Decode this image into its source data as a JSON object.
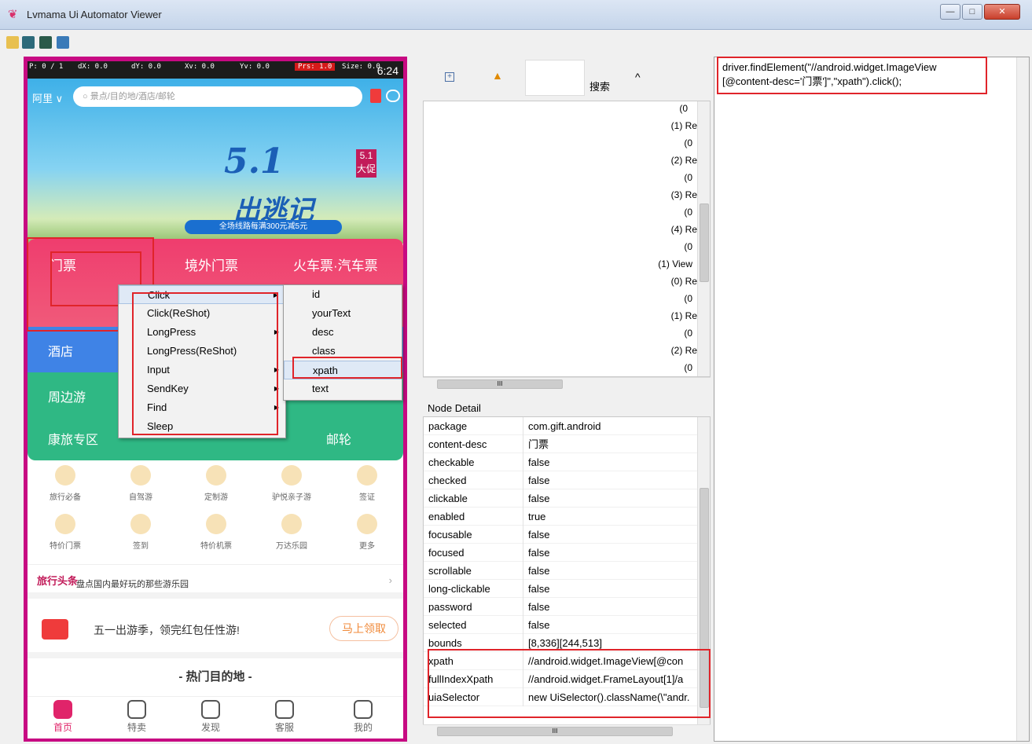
{
  "window": {
    "title": "Lvmama Ui Automator Viewer"
  },
  "phone": {
    "status": {
      "p": "P: 0 / 1",
      "dx": "dX: 0.0",
      "dy": "dY: 0.0",
      "xv": "Xv: 0.0",
      "yv": "Yv: 0.0",
      "prs": "Prs: 1.0",
      "size": "Size: 0.0",
      "time": "6:24"
    },
    "search": {
      "city": "阿里 ∨",
      "placeholder": "景点/目的地/酒店/邮轮"
    },
    "banner": {
      "line1": "5.1",
      "line2": "出逃记",
      "strip": "全场线路每满300元减5元",
      "badge": "5.1 大促"
    },
    "categories": {
      "tickets": "门票",
      "overseas_tickets": "境外门票",
      "train": "火车票·汽车票",
      "hotel": "酒店",
      "nearby": "周边游",
      "health": "康旅专区",
      "cruise": "邮轮"
    },
    "icons": [
      {
        "label": "旅行必备"
      },
      {
        "label": "自驾游"
      },
      {
        "label": "定制游"
      },
      {
        "label": "驴悦亲子游"
      },
      {
        "label": "签证"
      },
      {
        "label": "特价门票"
      },
      {
        "label": "签到"
      },
      {
        "label": "特价机票"
      },
      {
        "label": "万达乐园"
      },
      {
        "label": "更多"
      }
    ],
    "news": {
      "logo": "旅行头条",
      "text": "盘点国内最好玩的那些游乐园"
    },
    "promo": {
      "text": "五一出游季，领完红包任性游!",
      "button": "马上领取"
    },
    "hot": {
      "title": "- 热门目的地 -"
    },
    "tabs": [
      {
        "label": "首页"
      },
      {
        "label": "特卖"
      },
      {
        "label": "发现"
      },
      {
        "label": "客服"
      },
      {
        "label": "我的"
      }
    ]
  },
  "context_menu": {
    "items": [
      "Click",
      "Click(ReShot)",
      "LongPress",
      "LongPress(ReShot)",
      "Input",
      "SendKey",
      "Find",
      "Sleep"
    ],
    "submenu": [
      "id",
      "yourText",
      "desc",
      "class",
      "xpath",
      "text"
    ]
  },
  "tree_toolbar": {
    "search_label": "搜索"
  },
  "tree": {
    "items": [
      "(0",
      "(1) Re",
      "(0",
      "(2) Re",
      "(0",
      "(3) Re",
      "(0",
      "(4) Re",
      "(0",
      "(1) View",
      "(0) Re",
      "(0",
      "(1) Re",
      "(0",
      "(2) Re",
      "(0"
    ]
  },
  "scroll": {
    "h_mark": "III"
  },
  "node_detail": {
    "title": "Node Detail",
    "rows": [
      {
        "key": "package",
        "value": "com.gift.android"
      },
      {
        "key": "content-desc",
        "value": "门票"
      },
      {
        "key": "checkable",
        "value": "false"
      },
      {
        "key": "checked",
        "value": "false"
      },
      {
        "key": "clickable",
        "value": "false"
      },
      {
        "key": "enabled",
        "value": "true"
      },
      {
        "key": "focusable",
        "value": "false"
      },
      {
        "key": "focused",
        "value": "false"
      },
      {
        "key": "scrollable",
        "value": "false"
      },
      {
        "key": "long-clickable",
        "value": "false"
      },
      {
        "key": "password",
        "value": "false"
      },
      {
        "key": "selected",
        "value": "false"
      },
      {
        "key": "bounds",
        "value": "[8,336][244,513]"
      },
      {
        "key": "xpath",
        "value": "//android.widget.ImageView[@con"
      },
      {
        "key": "fullIndexXpath",
        "value": "//android.widget.FrameLayout[1]/a"
      },
      {
        "key": "uiaSelector",
        "value": "new UiSelector().className(\\\"andr."
      }
    ]
  },
  "code": {
    "line1": "driver.findElement(\"//android.widget.ImageView",
    "line2": "[@content-desc='门票']\",\"xpath\").click();"
  }
}
